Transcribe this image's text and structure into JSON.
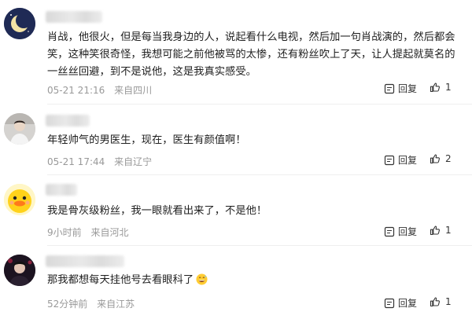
{
  "comments": [
    {
      "text": "肖战，他很火，但是每当我身边的人，说起看什么电视，然后加一句肖战演的，然后都会笑，这种笑很奇怪，我想可能之前他被骂的太惨，还有粉丝吹上了天，让人提起就莫名的一丝丝回避，到不是说他，这是我真实感受。",
      "time": "05-21 21:16",
      "location": "来自四川",
      "reply_label": "回复",
      "likes": "1",
      "avatar_icon": "moon-icon"
    },
    {
      "text": "年轻帅气的男医生，现在，医生有颜值啊！",
      "time": "05-21 17:44",
      "location": "来自辽宁",
      "reply_label": "回复",
      "likes": "2",
      "avatar_icon": "user-photo"
    },
    {
      "text": "我是骨灰级粉丝，我一眼就看出来了，不是他！",
      "time": "9小时前",
      "location": "来自河北",
      "reply_label": "回复",
      "likes": "1",
      "avatar_icon": "duck-icon"
    },
    {
      "text": "那我都想每天挂他号去看眼科了",
      "time": "52分钟前",
      "location": "来自江苏",
      "reply_label": "回复",
      "likes": "1",
      "avatar_icon": "user-photo",
      "emoji": "grinning-sweat-emoji"
    }
  ]
}
